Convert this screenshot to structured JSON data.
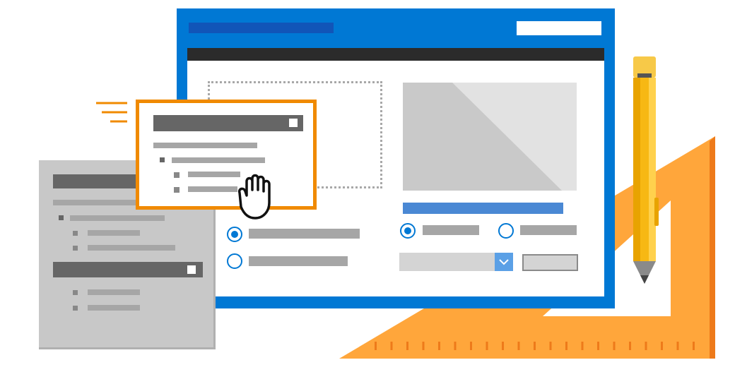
{
  "colors": {
    "window_blue": "#0078d4",
    "title_bar_dark_blue": "#1155b8",
    "accent_orange": "#f08a00",
    "ruler_orange": "#ffa63b",
    "ruler_edge": "#ee7a1a",
    "pencil_yellow": "#f7b813",
    "panel_gray": "#c8c8c8",
    "bar_dark_gray": "#666666",
    "bar_light_gray": "#a6a6a6",
    "image_gray": "#c9c9c9",
    "link_blue": "#4a88d4"
  },
  "icons": [
    "hand-cursor-icon",
    "pencil-icon",
    "triangle-ruler-icon",
    "motion-lines-icon",
    "image-placeholder-icon",
    "chevron-down-icon",
    "checkbox-icon"
  ],
  "form": {
    "radio_left_1_selected": true,
    "radio_left_2_selected": false,
    "radio_right_1_selected": true,
    "radio_right_2_selected": false
  }
}
